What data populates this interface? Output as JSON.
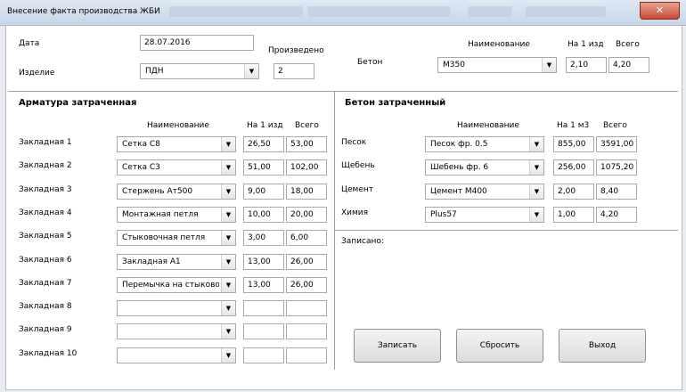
{
  "window": {
    "title": "Внесение факта производства ЖБИ",
    "close_label": "✕"
  },
  "header": {
    "date_label": "Дата",
    "date_value": "28.07.2016",
    "product_label": "Изделие",
    "product_value": "ПДН",
    "produced_label": "Произведено",
    "produced_value": "2",
    "concrete_label": "Бетон",
    "name_col": "Наименование",
    "per_unit_col": "На 1 изд",
    "total_col": "Всего",
    "concrete_grade": "М350",
    "concrete_per_unit": "2,10",
    "concrete_total": "4,20"
  },
  "rebar": {
    "title": "Арматура затраченная",
    "cols": {
      "name": "Наименование",
      "per_unit": "На 1 изд",
      "total": "Всего"
    },
    "rows": [
      {
        "label": "Закладная 1",
        "name": "Сетка С8",
        "per_unit": "26,50",
        "total": "53,00"
      },
      {
        "label": "Закладная 2",
        "name": "Сетка С3",
        "per_unit": "51,00",
        "total": "102,00"
      },
      {
        "label": "Закладная 3",
        "name": "Стержень Ат500",
        "per_unit": "9,00",
        "total": "18,00"
      },
      {
        "label": "Закладная 4",
        "name": "Монтажная петля",
        "per_unit": "10,00",
        "total": "20,00"
      },
      {
        "label": "Закладная 5",
        "name": "Стыковочная петля",
        "per_unit": "3,00",
        "total": "6,00"
      },
      {
        "label": "Закладная 6",
        "name": "Закладная А1",
        "per_unit": "13,00",
        "total": "26,00"
      },
      {
        "label": "Закладная 7",
        "name": "Перемычка на стыковочн",
        "per_unit": "13,00",
        "total": "26,00"
      },
      {
        "label": "Закладная 8",
        "name": "",
        "per_unit": "",
        "total": ""
      },
      {
        "label": "Закладная 9",
        "name": "",
        "per_unit": "",
        "total": ""
      },
      {
        "label": "Закладная 10",
        "name": "",
        "per_unit": "",
        "total": ""
      }
    ]
  },
  "concrete": {
    "title": "Бетон затраченный",
    "cols": {
      "name": "Наименование",
      "per_unit": "На 1 м3",
      "total": "Всего"
    },
    "rows": [
      {
        "label": "Песок",
        "name": "Песок фр. 0.5",
        "per_unit": "855,00",
        "total": "3591,00"
      },
      {
        "label": "Щебень",
        "name": "Шебень фр. 6",
        "per_unit": "256,00",
        "total": "1075,20"
      },
      {
        "label": "Цемент",
        "name": "Цемент М400",
        "per_unit": "2,00",
        "total": "8,40"
      },
      {
        "label": "Химия",
        "name": "Plus57",
        "per_unit": "1,00",
        "total": "4,20"
      }
    ]
  },
  "status": {
    "recorded_label": "Записано:"
  },
  "buttons": {
    "save": "Записать",
    "reset": "Сбросить",
    "exit": "Выход"
  },
  "icons": {
    "dropdown": "▼"
  }
}
